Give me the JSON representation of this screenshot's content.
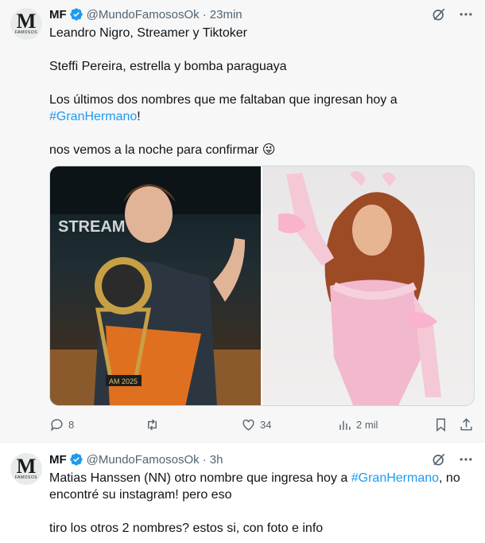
{
  "tweet1": {
    "avatar_letter": "M",
    "avatar_sub": "FAMOSOS",
    "name": "MF",
    "handle": "@MundoFamososOk",
    "time": "· 23min",
    "lines": [
      "Leandro Nigro, Streamer y Tiktoker",
      "",
      "Steffi Pereira, estrella y bomba paraguaya",
      "",
      "Los últimos dos nombres que me faltaban que ingresan hoy a"
    ],
    "hashtag": "#GranHermano",
    "hashtag_suffix": "!",
    "last_line": "nos vemos a la noche para confirmar 😜",
    "image_left_caption": "AM 2025",
    "image_left_backdrop": "STREAM JAM",
    "stats": {
      "replies": "8",
      "retweets": "",
      "likes": "34",
      "views": "2 mil"
    }
  },
  "tweet2": {
    "avatar_letter": "M",
    "avatar_sub": "FAMOSOS",
    "name": "MF",
    "handle": "@MundoFamososOk",
    "time": "· 3h",
    "line1_prefix": "Matias Hanssen (NN) otro nombre que ingresa hoy a",
    "hashtag": "#GranHermano",
    "line1_suffix": ", no",
    "line2": "encontré su instagram! pero eso",
    "line3": "tiro los otros 2 nombres? estos si, con foto e info"
  },
  "colors": {
    "accent": "#1d9bf0",
    "muted": "#536471",
    "text": "#0f1419"
  }
}
